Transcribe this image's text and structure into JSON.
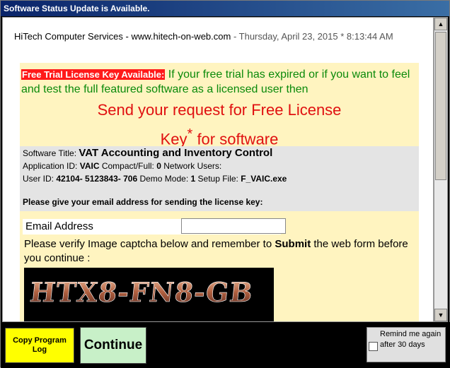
{
  "window": {
    "title": "Software Status Update is Available."
  },
  "header": {
    "company": "HiTech Computer Services - www.hitech-on-web.com",
    "date": " - Thursday, April 23, 2015 * 8:13:44 AM"
  },
  "trial": {
    "badge": "Free Trial License Key Available:",
    "text": " If your free trial has expired or if you want to feel and test the full featured software as a licensed user then"
  },
  "request": {
    "line1": "Send your request for Free License",
    "line2a": "Key",
    "star": "*",
    "line2b": " for software"
  },
  "info": {
    "title_label": "Software Title: ",
    "title_value": "VAT Accounting and Inventory Control",
    "appid_label": "Application ID: ",
    "appid_value": "VAIC",
    "compact_label": " Compact/Full: ",
    "compact_value": "0",
    "network_label": " Network Users:",
    "userid_label": "User ID: ",
    "userid_value": "42104- 5123843- 706",
    "demo_label": " Demo Mode: ",
    "demo_value": "1",
    "setup_label": " Setup File: ",
    "setup_value": "F_VAIC.exe",
    "email_prompt": "Please give your email address for sending the license key:"
  },
  "form": {
    "email_label": "Email Address",
    "email_value": "",
    "verify_a": "Please verify Image captcha below and remember to ",
    "verify_b": "Submit",
    "verify_c": " the web form before you continue :",
    "captcha_text": "HTX8-FN8-GB"
  },
  "footer": {
    "copy_label": "Copy Program Log",
    "continue_label": "Continue",
    "remind_label": "Remind me again after 30 days",
    "remind_checked": false
  },
  "colors": {
    "panel_bg": "#fff4c0",
    "trial_text": "#0a8a0a",
    "request_text": "#e01010",
    "copy_button": "#ffff00",
    "continue_button": "#c8f0c8"
  },
  "icons": {
    "scroll_up": "arrow-up-icon",
    "scroll_down": "arrow-down-icon",
    "checkbox": "checkbox-icon"
  }
}
